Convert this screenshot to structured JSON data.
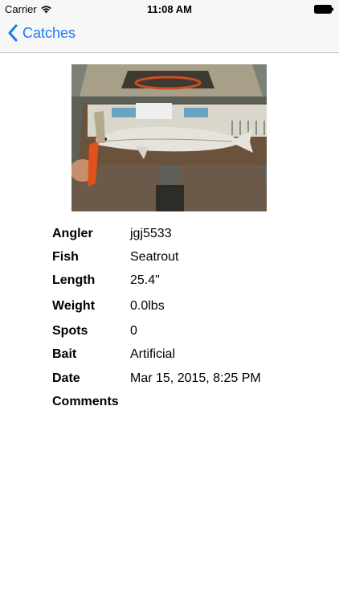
{
  "status_bar": {
    "carrier": "Carrier",
    "time": "11:08 AM"
  },
  "nav": {
    "back_label": "Catches",
    "accent_color": "#1a7cf0"
  },
  "photo": {
    "description_icon": "fish-photo"
  },
  "details": [
    {
      "label": "Angler",
      "value": "jgj5533"
    },
    {
      "label": "Fish",
      "value": "Seatrout"
    },
    {
      "label": "Length",
      "value": "25.4\""
    },
    {
      "label": "Weight",
      "value": "0.0lbs"
    },
    {
      "label": "Spots",
      "value": "0"
    },
    {
      "label": "Bait",
      "value": "Artificial"
    },
    {
      "label": "Date",
      "value": "Mar 15, 2015, 8:25 PM"
    },
    {
      "label": "Comments",
      "value": ""
    }
  ]
}
